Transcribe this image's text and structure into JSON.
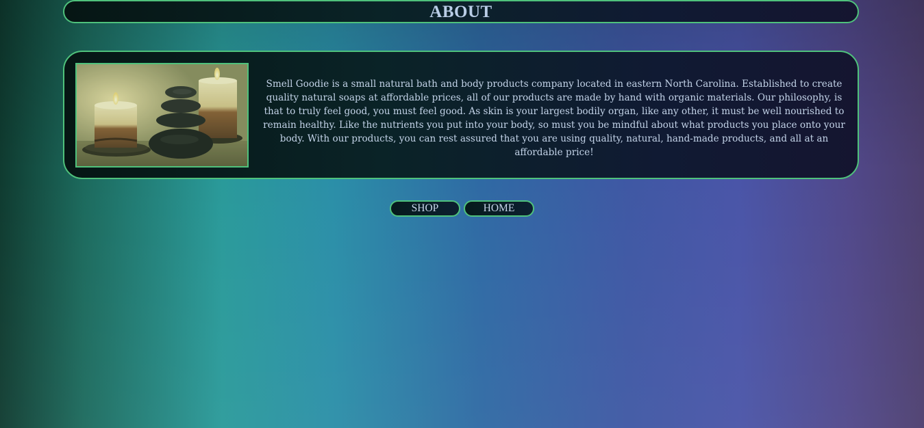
{
  "header": {
    "title": "ABOUT"
  },
  "about": {
    "image_subject": "candles-and-stacked-stones",
    "description": "Smell Goodie is a small natural bath and body products company located in eastern North Carolina. Established to create quality natural soaps at affordable prices, all of our products are made by hand with organic materials. Our philosophy, is that to truly feel good, you must feel good. As skin is your largest bodily organ, like any other, it must be well nourished to remain healthy. Like the nutrients you put into your body, so must you be mindful about what products you place onto your body. With our products, you can rest assured that you are using quality, natural, hand-made products, and all at an affordable price!"
  },
  "nav": {
    "shop_label": "SHOP",
    "home_label": "HOME"
  },
  "colors": {
    "accent_border": "#4fc27c",
    "text": "#c3d3e8"
  }
}
